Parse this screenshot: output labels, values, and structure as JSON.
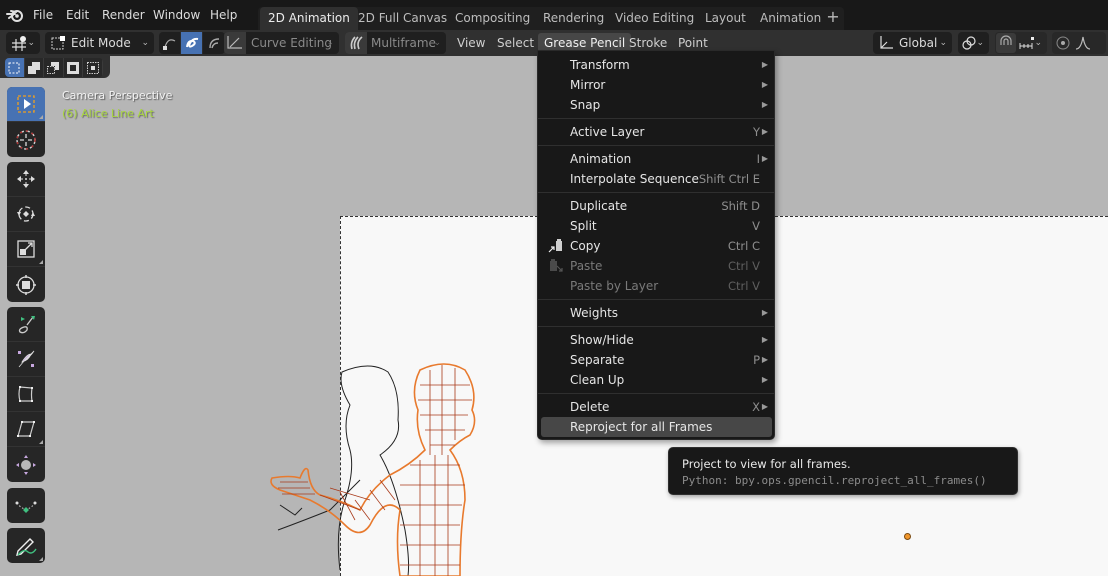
{
  "topbar": {
    "menus": [
      "File",
      "Edit",
      "Render",
      "Window",
      "Help"
    ],
    "workspaces": [
      {
        "label": "2D Animation",
        "active": true
      },
      {
        "label": "2D Full Canvas",
        "active": false
      },
      {
        "label": "Compositing",
        "active": false
      },
      {
        "label": "Rendering",
        "active": false
      },
      {
        "label": "Video Editing",
        "active": false
      },
      {
        "label": "Layout",
        "active": false
      },
      {
        "label": "Animation",
        "active": false
      }
    ],
    "add_workspace_icon": "+"
  },
  "header": {
    "mode": "Edit Mode",
    "curve_editing": "Curve Editing",
    "multiframe": "Multiframe",
    "menus": [
      "View",
      "Select",
      "Grease Pencil",
      "Stroke",
      "Point"
    ],
    "open_menu": "Grease Pencil",
    "transform_orientation": "Global"
  },
  "viewport": {
    "camera_label": "Camera Perspective",
    "object_label": "(6) Alice Line Art",
    "object_label_color": "#a8d63f",
    "accent_color": "#4772b3"
  },
  "toolbar": {
    "tools": [
      "Select Box",
      "Cursor",
      "Move",
      "Rotate",
      "Scale",
      "Transform",
      "Radius",
      "Shear",
      "Bend",
      "To Sphere",
      "Transform Fill",
      "Interpolate",
      "Draw"
    ],
    "active_tool": "Select Box"
  },
  "dropdown": {
    "items": [
      {
        "label": "Transform",
        "shortcut": "",
        "submenu": true,
        "disabled": false
      },
      {
        "label": "Mirror",
        "shortcut": "",
        "submenu": true,
        "disabled": false
      },
      {
        "label": "Snap",
        "shortcut": "",
        "submenu": true,
        "disabled": false
      },
      {
        "label": "Active Layer",
        "shortcut": "Y",
        "submenu": true,
        "disabled": false
      },
      {
        "label": "Animation",
        "shortcut": "I",
        "submenu": true,
        "disabled": false
      },
      {
        "label": "Interpolate Sequence",
        "shortcut": "Shift Ctrl E",
        "submenu": false,
        "disabled": false
      },
      {
        "label": "Duplicate",
        "shortcut": "Shift D",
        "submenu": false,
        "disabled": false
      },
      {
        "label": "Split",
        "shortcut": "V",
        "submenu": false,
        "disabled": false
      },
      {
        "label": "Copy",
        "shortcut": "Ctrl C",
        "submenu": false,
        "disabled": false,
        "icon": "copy-icon"
      },
      {
        "label": "Paste",
        "shortcut": "Ctrl V",
        "submenu": false,
        "disabled": true,
        "icon": "paste-icon"
      },
      {
        "label": "Paste by Layer",
        "shortcut": "Ctrl V",
        "submenu": false,
        "disabled": true
      },
      {
        "label": "Weights",
        "shortcut": "",
        "submenu": true,
        "disabled": false
      },
      {
        "label": "Show/Hide",
        "shortcut": "",
        "submenu": true,
        "disabled": false
      },
      {
        "label": "Separate",
        "shortcut": "P",
        "submenu": true,
        "disabled": false
      },
      {
        "label": "Clean Up",
        "shortcut": "",
        "submenu": true,
        "disabled": false
      },
      {
        "label": "Delete",
        "shortcut": "X",
        "submenu": true,
        "disabled": false
      },
      {
        "label": "Reproject for all Frames",
        "shortcut": "",
        "submenu": false,
        "disabled": false,
        "highlighted": true
      }
    ]
  },
  "tooltip": {
    "description": "Project to view for all frames.",
    "python": "Python: bpy.ops.gpencil.reproject_all_frames()"
  }
}
